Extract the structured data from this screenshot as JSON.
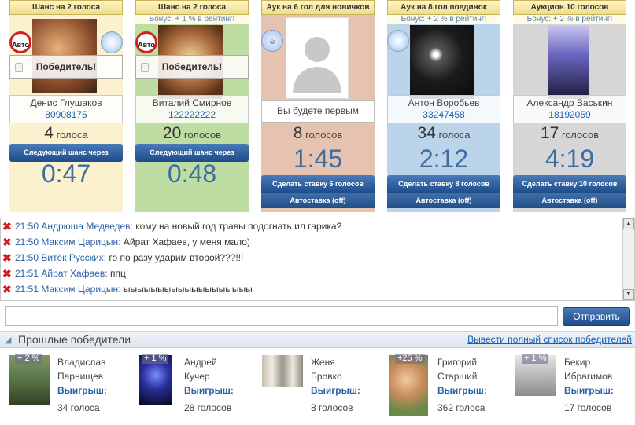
{
  "auctions": [
    {
      "head": "Шанс на 2 голоса",
      "bonus": "",
      "name": "Денис Глушаков",
      "id": "80908175",
      "votes_num": "4",
      "votes_word": "голоса",
      "next_label": "Следующий шанс через",
      "timer": "0:47",
      "winner": "Победитель!",
      "left_badge": "Авто",
      "bg": "#fbf1cf"
    },
    {
      "head": "Шанс на 2 голоса",
      "bonus": "Бонус: + 1 % в рейтинг!",
      "name": "Виталий Смирнов",
      "id": "122222222",
      "votes_num": "20",
      "votes_word": "голосов",
      "next_label": "Следующий шанс через",
      "timer": "0:48",
      "winner": "Победитель!",
      "left_badge": "Авто",
      "bg": "#bfdca3"
    },
    {
      "head": "Аук на 6 гол для новичков",
      "bonus": "",
      "placeholder": "Вы будете первым",
      "votes_num": "8",
      "votes_word": "голосов",
      "timer": "1:45",
      "bid_label": "Сделать ставку 6 голосов",
      "auto_label": "Автоставка (off)",
      "bg": "#e6c3b0"
    },
    {
      "head": "Аук на 8 гол поединок",
      "bonus": "Бонус: + 2 % в рейтинг!",
      "name": "Антон Воробьев",
      "id": "33247458",
      "votes_num": "34",
      "votes_word": "голоса",
      "timer": "2:12",
      "bid_label": "Сделать ставку 8 голосов",
      "auto_label": "Автоставка (off)",
      "bg": "#bcd4ea"
    },
    {
      "head": "Аукцион 10 голосов",
      "bonus": "Бонус: + 2 % в рейтинг!",
      "name": "Александр Васькин",
      "id": "18192059",
      "votes_num": "17",
      "votes_word": "голосов",
      "timer": "4:19",
      "bid_label": "Сделать ставку 10 голосов",
      "auto_label": "Автоставка (off)",
      "bg": "#d6d6d6"
    }
  ],
  "chat": [
    {
      "time": "21:50",
      "user": "Андрюша Медведев:",
      "msg": "кому на новый год травы подогнать ил гарика?"
    },
    {
      "time": "21:50",
      "user": "Максим Царицын:",
      "msg": "Айрат Хафаев, у меня мало)"
    },
    {
      "time": "21:50",
      "user": "Витёк Русских:",
      "msg": "го по разу ударим второй???!!!"
    },
    {
      "time": "21:51",
      "user": "Айрат Хафаев:",
      "msg": "ппц"
    },
    {
      "time": "21:51",
      "user": "Максим Царицын:",
      "msg": "ыыыыыыыыыыыыыыыыыыы"
    }
  ],
  "send_label": "Отправить",
  "past": {
    "title": "Прошлые победители",
    "all_link": "Вывести полный список победителей",
    "winners": [
      {
        "pct": "+ 2 %",
        "first": "Владислав",
        "last": "Парнищев",
        "win_label": "Выигрыш:",
        "count": "34 голоса"
      },
      {
        "pct": "+ 1 %",
        "first": "Андрей",
        "last": "Кучер",
        "win_label": "Выигрыш:",
        "count": "28 голосов"
      },
      {
        "pct": "",
        "first": "Женя",
        "last": "Бровко",
        "win_label": "Выигрыш:",
        "count": "8 голосов"
      },
      {
        "pct": "+25 %",
        "first": "Григорий",
        "last": "Старший",
        "win_label": "Выигрыш:",
        "count": "362 голоса"
      },
      {
        "pct": "+ 1 %",
        "first": "Бекир",
        "last": "Ибрагимов",
        "win_label": "Выигрыш:",
        "count": "17 голосов"
      }
    ]
  }
}
